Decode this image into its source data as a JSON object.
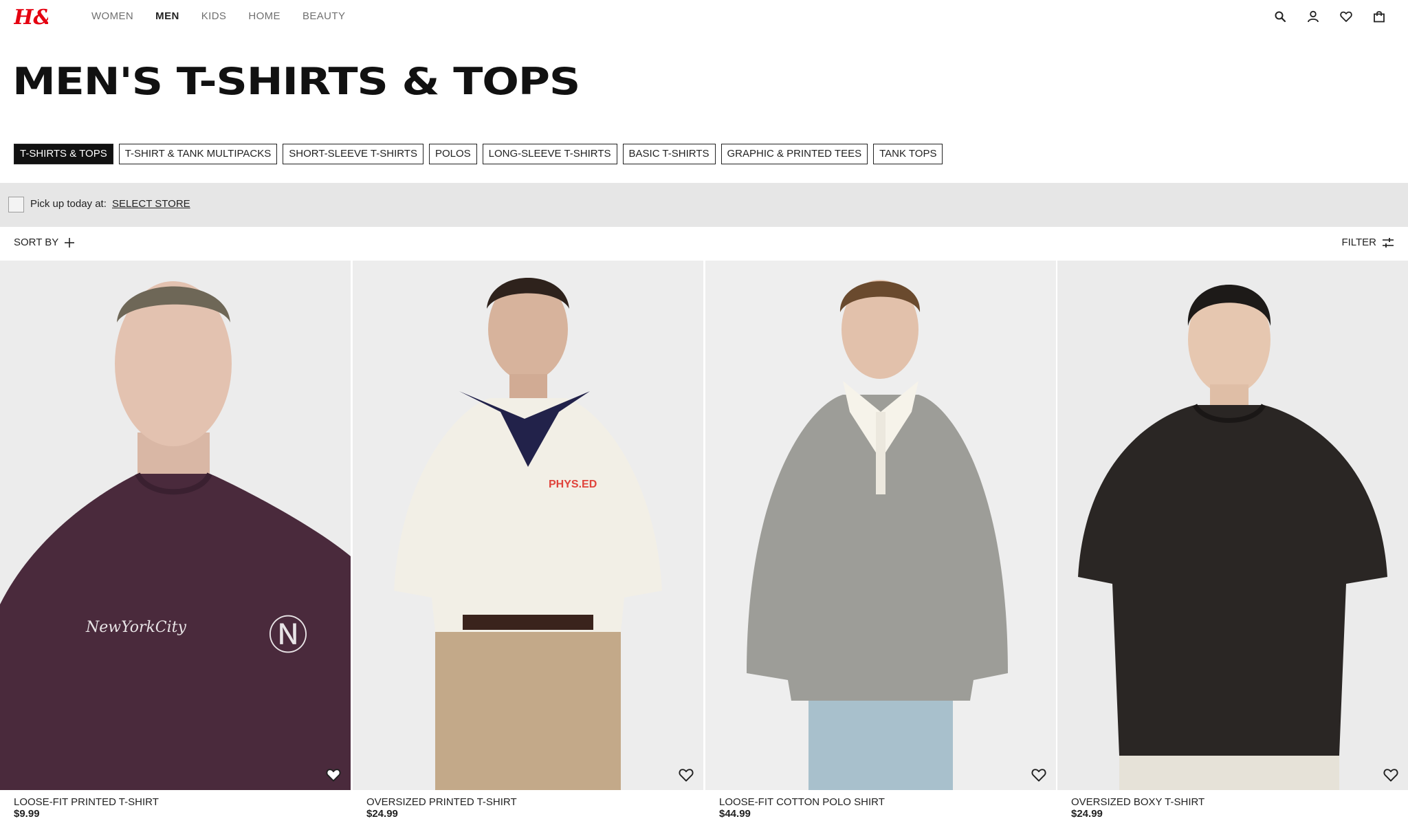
{
  "brand": {
    "logo_text": "H&M",
    "accent": "#e50010"
  },
  "nav": [
    "WOMEN",
    "MEN",
    "KIDS",
    "HOME",
    "BEAUTY"
  ],
  "nav_active": "MEN",
  "header_icons": [
    "search-icon",
    "account-icon",
    "favorites-icon",
    "bag-icon"
  ],
  "page": {
    "title": "MEN'S T-SHIRTS & TOPS"
  },
  "categories": [
    "T-SHIRTS & TOPS",
    "T-SHIRT & TANK MULTIPACKS",
    "SHORT-SLEEVE T-SHIRTS",
    "POLOS",
    "LONG-SLEEVE T-SHIRTS",
    "BASIC T-SHIRTS",
    "GRAPHIC & PRINTED TEES",
    "TANK TOPS"
  ],
  "active_category": "T-SHIRTS & TOPS",
  "pickup": {
    "label": "Pick up today at:",
    "link": "SELECT STORE",
    "checked": false
  },
  "toolbar": {
    "sort_label": "SORT BY",
    "filter_label": "FILTER"
  },
  "products": [
    {
      "name": "LOOSE-FIT PRINTED T-SHIRT",
      "price": "$9.99",
      "shirt_color": "#4a2a3c",
      "graphic_text": "NewYorkCity"
    },
    {
      "name": "OVERSIZED PRINTED T-SHIRT",
      "price": "$24.99",
      "shirt_color": "#f2efe6",
      "graphic_text": "PHYS.ED"
    },
    {
      "name": "LOOSE-FIT COTTON POLO SHIRT",
      "price": "$44.99",
      "shirt_color": "#9d9d98",
      "graphic_text": ""
    },
    {
      "name": "OVERSIZED BOXY T-SHIRT",
      "price": "$24.99",
      "shirt_color": "#2a2624",
      "graphic_text": ""
    }
  ]
}
